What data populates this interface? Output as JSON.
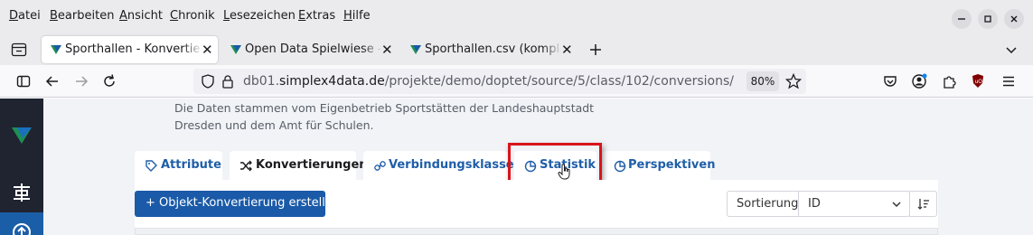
{
  "menubar": {
    "items": [
      {
        "acc": "D",
        "rest": "atei"
      },
      {
        "acc": "B",
        "rest": "earbeiten"
      },
      {
        "acc": "A",
        "rest": "nsicht"
      },
      {
        "acc": "C",
        "rest": "hronik"
      },
      {
        "acc": "L",
        "rest": "esezeichen"
      },
      {
        "acc": "E",
        "rest": "xtras"
      },
      {
        "acc": "H",
        "rest": "ilfe"
      }
    ]
  },
  "tabs": [
    {
      "label": "Sporthallen - Konvertierung",
      "active": true
    },
    {
      "label": "Open Data Spielwiese - Q",
      "active": false
    },
    {
      "label": "Sporthallen.csv (komplett",
      "active": false
    }
  ],
  "address": {
    "prefix": "db01.",
    "domain": "simplex4data.de",
    "path": "/projekte/demo/doptet/source/5/class/102/conversions/",
    "zoom": "80%"
  },
  "page": {
    "description_lines": [
      "Die Daten stammen vom Eigenbetrieb Sportstätten der Landeshauptstadt",
      "Dresden und dem Amt für Schulen."
    ],
    "tabs": [
      {
        "label": "Attribute",
        "icon": "tag-icon"
      },
      {
        "label": "Konvertierungen",
        "icon": "shuffle-icon"
      },
      {
        "label": "Verbindungsklassen",
        "icon": "link-icon"
      },
      {
        "label": "Statistik",
        "icon": "pie-chart-icon"
      },
      {
        "label": "Perspektiven",
        "icon": "pie-chart-icon"
      }
    ],
    "create_button": "+ Objekt-Konvertierung erstellen",
    "sort": {
      "label": "Sortierung",
      "value": "ID"
    }
  },
  "colors": {
    "accent": "#1a5aa8",
    "highlight": "#d8141b",
    "sidebar": "#1f2430"
  }
}
